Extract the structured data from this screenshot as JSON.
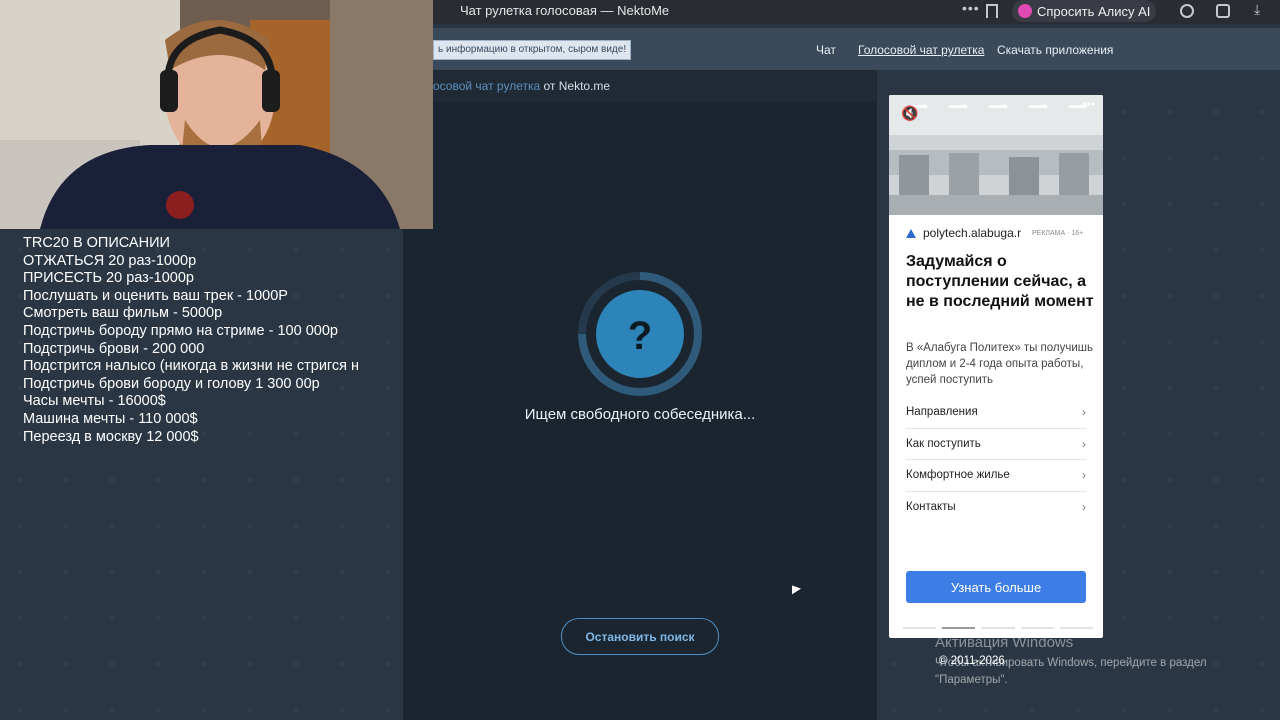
{
  "browser": {
    "tab_title": "Чат рулетка голосовая — NektoMe",
    "more": "•••",
    "alisa_label": "Спросить Алису AI"
  },
  "site": {
    "notice": "ь информацию в открытом, сыром виде!",
    "nav": [
      "Чат",
      "Голосовой чат рулетка",
      "Скачать приложения"
    ]
  },
  "chat": {
    "subheader_highlight": "осовой чат рулетка",
    "subheader_suffix": " от Nekto.me",
    "question_mark": "?",
    "search_text": "Ищем свободного собеседника...",
    "stop_button": "Остановить поиск"
  },
  "overlay_lines": [
    "TRC20 В ОПИСАНИИ",
    "ОТЖАТЬСЯ 20 раз-1000р",
    "ПРИСЕСТЬ 20 раз-1000р",
    "Послушать и оценить ваш трек - 1000Р",
    "Смотреть ваш фильм - 5000р",
    "Подстричь бороду прямо на стриме - 100 000р",
    "Подстричь брови - 200 000",
    "Подстрится налысо (никогда в жизни не стригся н",
    "Подстричь брови бороду и голову 1 300 00р",
    "Часы мечты - 16000$",
    "Машина мечты - 110 000$",
    "Переезд в москву 12 000$"
  ],
  "ad": {
    "more": "•••",
    "domain": "polytech.alabuga.r",
    "label": "РЕКЛАМА · 16+",
    "headline": "Задумайся о поступлении сейчас, а не в последний момент",
    "body": "В «Алабуга Политех» ты получишь диплом и 2-4 года опыта работы, успей поступить",
    "menu": [
      "Направления",
      "Как поступить",
      "Комфортное жилье",
      "Контакты"
    ],
    "cta": "Узнать больше"
  },
  "watermark": {
    "title": "Активация Windows",
    "subtitle": "Чтобы активировать Windows, перейдите в раздел \"Параметры\"."
  },
  "footer": {
    "copyright": "© 2011-2026"
  }
}
